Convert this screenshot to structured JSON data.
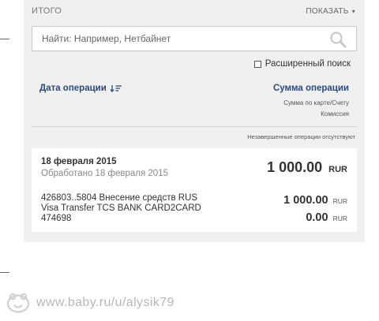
{
  "header": {
    "title": "ИТОГО",
    "show_label": "ПОКАЗАТЬ",
    "show_caret": "▾"
  },
  "search": {
    "placeholder": "Найти: Например, Нетбайнет",
    "icon": "search-icon"
  },
  "advanced_search": {
    "label": "Расширенный поиск",
    "checked": false
  },
  "columns": {
    "date_label": "Дата операции",
    "sum_label": "Сумма операции",
    "sum_sub1": "Сумма по карте/Счету",
    "sum_sub2": "Комиссия"
  },
  "pending_note": "Незавершенные операции отсутствуют",
  "operation": {
    "date": "18 февраля 2015",
    "processed": "Обработано 18 февраля 2015",
    "total_amount": "1 000.00",
    "total_currency": "RUR",
    "desc_line1": "426803..5804 Внесение средств RUS",
    "desc_line2": "Visa Transfer TCS BANK CARD2CARD",
    "desc_line3": "474698",
    "card_amount": "1 000.00",
    "card_currency": "RUR",
    "fee_amount": "0.00",
    "fee_currency": "RUR"
  },
  "watermark": {
    "text": "www.baby.ru/u/alysik79"
  },
  "colors": {
    "link_blue": "#2b4a7e",
    "panel_bg": "#f0f0f0"
  }
}
